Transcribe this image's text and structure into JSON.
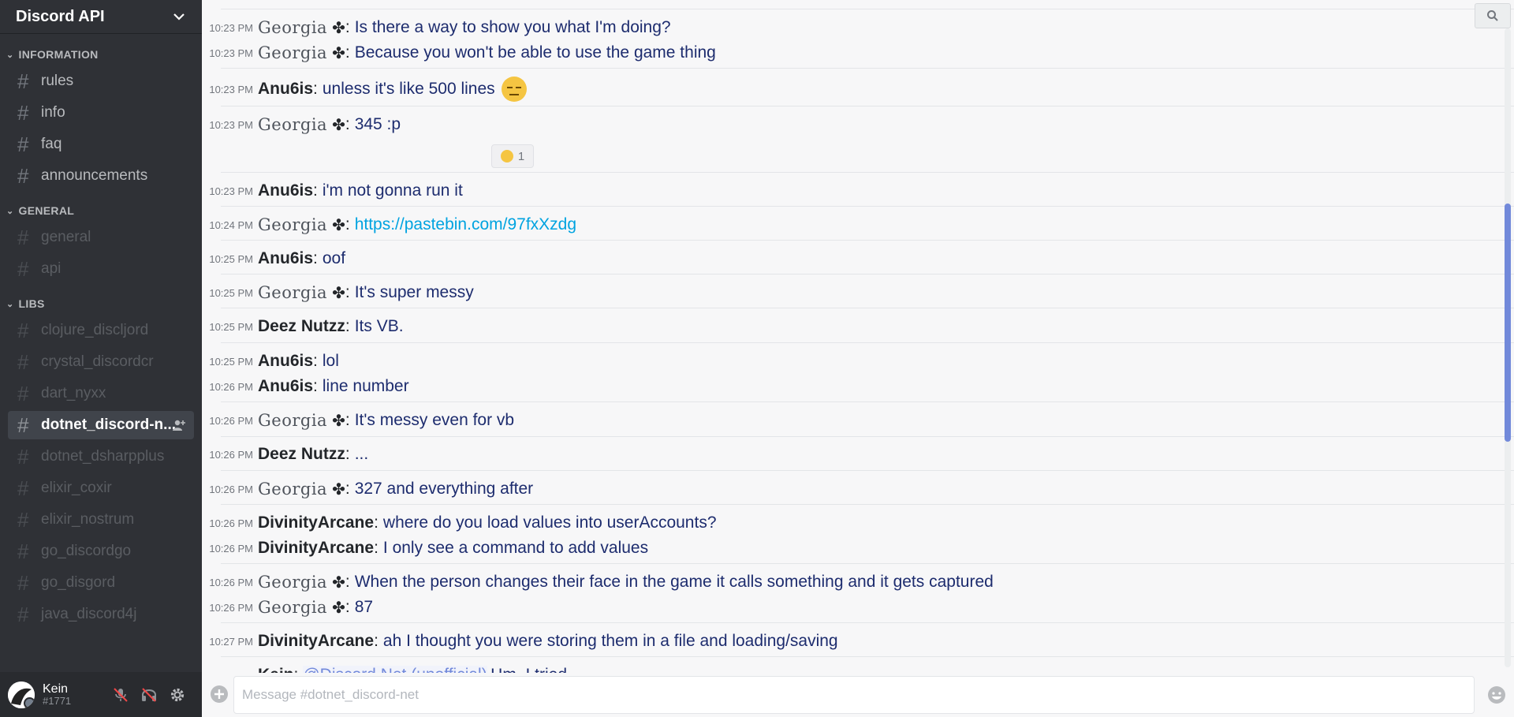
{
  "guild": {
    "name": "Discord API"
  },
  "categories": {
    "information": "INFORMATION",
    "general": "GENERAL",
    "libs": "LIBS"
  },
  "channels": {
    "information": [
      "rules",
      "info",
      "faq",
      "announcements"
    ],
    "general": [
      "general",
      "api"
    ],
    "libs": [
      "clojure_discljord",
      "crystal_discordcr",
      "dart_nyxx",
      "dotnet_discord-n...",
      "dotnet_dsharpplus",
      "elixir_coxir",
      "elixir_nostrum",
      "go_discordgo",
      "go_disgord",
      "java_discord4j"
    ]
  },
  "user": {
    "name": "Kein",
    "discriminator": "#1771"
  },
  "messages": [
    {
      "time": "10:23 PM",
      "author": "Georgia",
      "text": "Is there a way to show you what I'm doing?"
    },
    {
      "time": "10:23 PM",
      "author": "Georgia",
      "text": "Because you won't be able to use the game thing"
    },
    {
      "time": "10:23 PM",
      "author": "Anu6is",
      "text": "unless it's like 500 lines"
    },
    {
      "time": "10:23 PM",
      "author": "Georgia",
      "text": "345 :p"
    },
    {
      "time": "10:23 PM",
      "author": "Anu6is",
      "text": "i'm not gonna run it"
    },
    {
      "time": "10:24 PM",
      "author": "Georgia",
      "text": "https://pastebin.com/97fxXzdg"
    },
    {
      "time": "10:25 PM",
      "author": "Anu6is",
      "text": "oof"
    },
    {
      "time": "10:25 PM",
      "author": "Georgia",
      "text": "It's super messy"
    },
    {
      "time": "10:25 PM",
      "author": "Deez Nutzz",
      "text": "Its VB."
    },
    {
      "time": "10:25 PM",
      "author": "Anu6is",
      "text": "lol"
    },
    {
      "time": "10:26 PM",
      "author": "Anu6is",
      "text": "line number"
    },
    {
      "time": "10:26 PM",
      "author": "Georgia",
      "text": "It's messy even for vb"
    },
    {
      "time": "10:26 PM",
      "author": "Deez Nutzz",
      "text": "..."
    },
    {
      "time": "10:26 PM",
      "author": "Georgia",
      "text": "327 and everything after"
    },
    {
      "time": "10:26 PM",
      "author": "DivinityArcane",
      "text": "where do you load values into userAccounts?"
    },
    {
      "time": "10:26 PM",
      "author": "DivinityArcane",
      "text": "I only see a command to add values"
    },
    {
      "time": "10:26 PM",
      "author": "Georgia",
      "text": "When the person changes their face in the game it calls something and it gets captured"
    },
    {
      "time": "10:26 PM",
      "author": "Georgia",
      "text": "87"
    },
    {
      "time": "10:27 PM",
      "author": "DivinityArcane",
      "text": "ah I thought you were storing them in a file and loading/saving"
    },
    {
      "time": "",
      "author": "Kein",
      "text": "Hm, I tried"
    }
  ],
  "partial_mention": "@Discord.Net (unofficial)",
  "reaction": {
    "count": "1"
  },
  "input": {
    "placeholder": "Message #dotnet_discord-net"
  },
  "colors": {
    "accent": "#7289da",
    "link": "#00a3e0",
    "text": "#1d2c6e"
  }
}
